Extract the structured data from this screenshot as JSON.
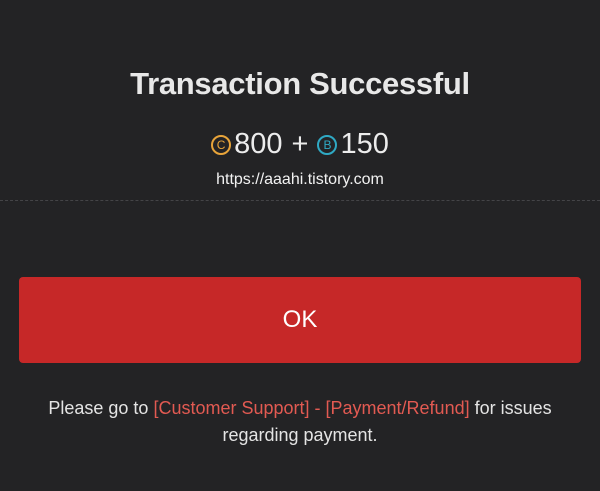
{
  "dialog": {
    "title": "Transaction Successful",
    "amount": {
      "coin_c_symbol": "C",
      "coin_c_value": "800",
      "plus": "+",
      "coin_b_symbol": "B",
      "coin_b_value": "150"
    },
    "url": "https://aaahi.tistory.com",
    "ok_label": "OK",
    "notice": {
      "prefix": "Please go to ",
      "link_support": "[Customer Support]",
      "separator": " - ",
      "link_payment": "[Payment/Refund]",
      "suffix": " for issues regarding payment."
    }
  },
  "colors": {
    "background": "#232325",
    "button": "#c62828",
    "link": "#e25a52",
    "coin_c": "#e8a43a",
    "coin_b": "#2fa9c4"
  }
}
